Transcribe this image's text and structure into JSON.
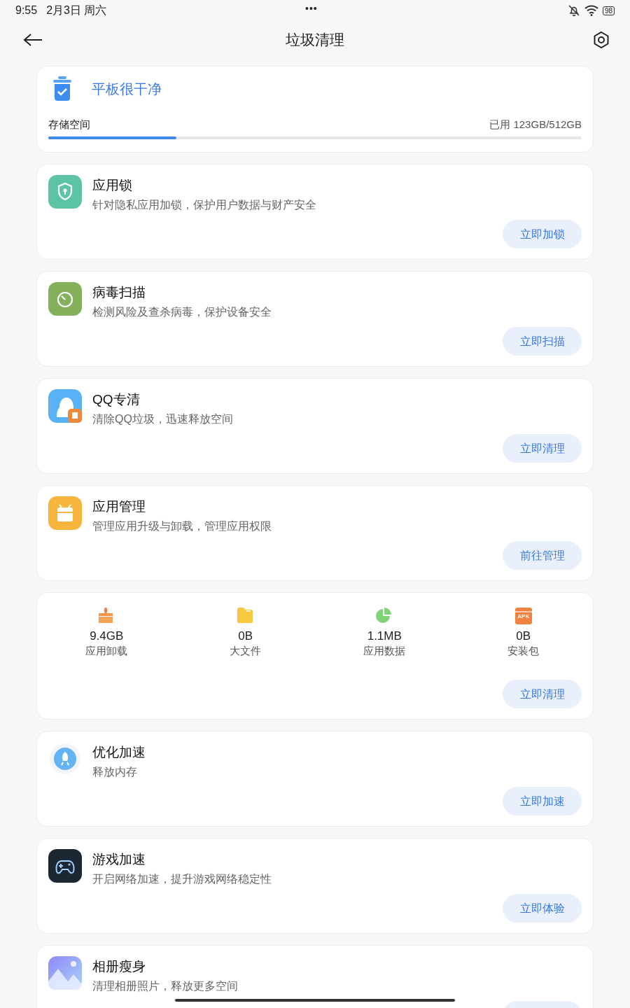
{
  "status_bar": {
    "time": "9:55",
    "date": "2月3日 周六",
    "dots": "•••",
    "battery": "98"
  },
  "header": {
    "title": "垃圾清理"
  },
  "storage": {
    "status": "平板很干净",
    "label": "存储空间",
    "usage": "已用 123GB/512GB",
    "level": 0.24
  },
  "cards": [
    {
      "kind": "feature",
      "title": "应用锁",
      "desc": "针对隐私应用加锁，保护用户数据与财产安全",
      "button": "立即加锁"
    },
    {
      "kind": "feature",
      "title": "病毒扫描",
      "desc": "检测风险及查杀病毒，保护设备安全",
      "button": "立即扫描"
    },
    {
      "kind": "feature",
      "title": "QQ专清",
      "desc": "清除QQ垃圾，迅速释放空间",
      "button": "立即清理"
    },
    {
      "kind": "feature",
      "title": "应用管理",
      "desc": "管理应用升级与卸载，管理应用权限",
      "button": "前往管理"
    },
    {
      "kind": "stats",
      "stats": [
        {
          "value": "9.4GB",
          "label": "应用卸载"
        },
        {
          "value": "0B",
          "label": "大文件"
        },
        {
          "value": "1.1MB",
          "label": "应用数据"
        },
        {
          "value": "0B",
          "label": "安装包",
          "badge": "APK"
        }
      ],
      "button": "立即清理"
    },
    {
      "kind": "feature",
      "title": "优化加速",
      "desc": "释放内存",
      "button": "立即加速"
    },
    {
      "kind": "feature",
      "title": "游戏加速",
      "desc": "开启网络加速，提升游戏网络稳定性",
      "button": "立即体验"
    },
    {
      "kind": "feature",
      "title": "相册瘦身",
      "desc": "清理相册照片，释放更多空间"
    }
  ]
}
